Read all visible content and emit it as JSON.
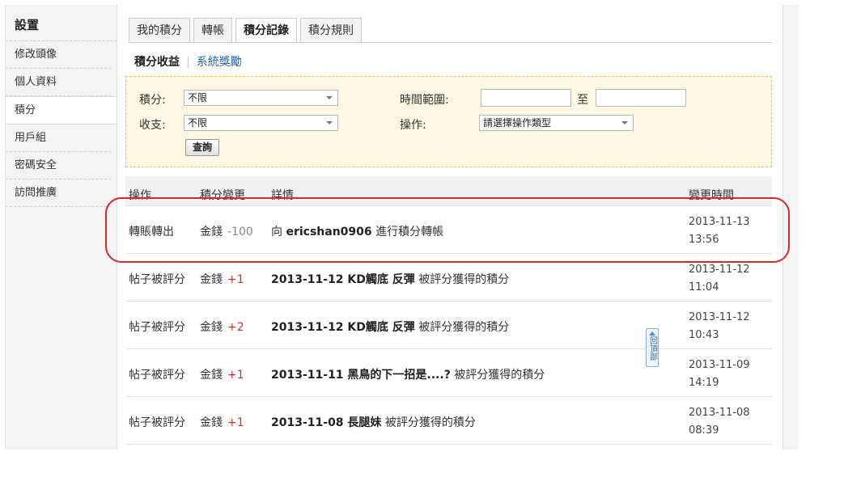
{
  "sidebar": {
    "title": "設置",
    "items": [
      {
        "label": "修改頭像"
      },
      {
        "label": "個人資料"
      },
      {
        "label": "積分"
      },
      {
        "label": "用戶組"
      },
      {
        "label": "密碼安全"
      },
      {
        "label": "訪問推廣"
      }
    ]
  },
  "tabs": [
    {
      "label": "我的積分"
    },
    {
      "label": "轉帳"
    },
    {
      "label": "積分記錄"
    },
    {
      "label": "積分規則"
    }
  ],
  "subnav": {
    "active": "積分收益",
    "link": "系統獎勵"
  },
  "filter": {
    "points_label": "積分:",
    "points_value": "不限",
    "income_label": "收支:",
    "income_value": "不限",
    "time_label": "時間範圍:",
    "to_label": "至",
    "operation_label": "操作:",
    "operation_value": "請選擇操作類型",
    "query_button": "查詢"
  },
  "table": {
    "headers": {
      "op": "操作",
      "change": "積分變更",
      "detail": "詳情",
      "time": "變更時間"
    },
    "rows": [
      {
        "op": "轉賬轉出",
        "currency": "金錢",
        "amount": "-100",
        "detail_prefix": "向 ",
        "detail_bold": "ericshan0906",
        "detail_suffix": " 進行積分轉帳",
        "date": "2013-11-13",
        "clock": "13:56"
      },
      {
        "op": "帖子被評分",
        "currency": "金錢",
        "amount": "+1",
        "detail_prefix": "",
        "detail_bold": "2013-11-12 KD觸底 反彈",
        "detail_suffix": " 被評分獲得的積分",
        "date": "2013-11-12",
        "clock": "11:04"
      },
      {
        "op": "帖子被評分",
        "currency": "金錢",
        "amount": "+2",
        "detail_prefix": "",
        "detail_bold": "2013-11-12 KD觸底 反彈",
        "detail_suffix": " 被評分獲得的積分",
        "date": "2013-11-12",
        "clock": "10:43"
      },
      {
        "op": "帖子被評分",
        "currency": "金錢",
        "amount": "+1",
        "detail_prefix": "",
        "detail_bold": "2013-11-11 黑鳥的下一招是....?",
        "detail_suffix": " 被評分獲得的積分",
        "date": "2013-11-09",
        "clock": "14:19"
      },
      {
        "op": "帖子被評分",
        "currency": "金錢",
        "amount": "+1",
        "detail_prefix": "",
        "detail_bold": "2013-11-08 長腿妹",
        "detail_suffix": " 被評分獲得的積分",
        "date": "2013-11-08",
        "clock": "08:39"
      }
    ]
  },
  "back_to_top": "回頂部",
  "colors": {
    "highlight": "#d42a2a",
    "positive": "#c0392b",
    "link": "#2366a8"
  }
}
